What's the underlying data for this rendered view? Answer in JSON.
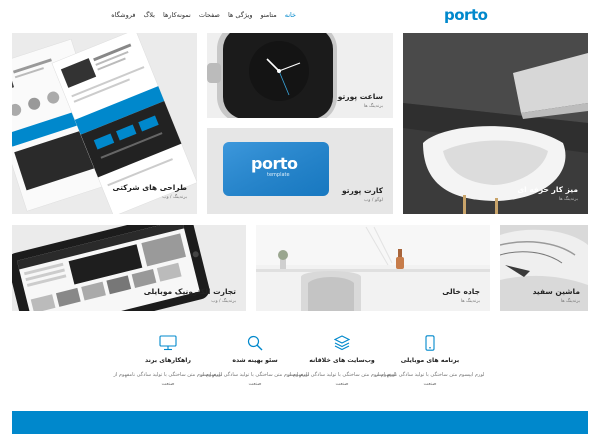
{
  "header": {
    "logo_text": "porto",
    "nav": [
      "خانه",
      "متامنو",
      "ویژگی ها",
      "صفحات",
      "نمونه‌کارها",
      "بلاگ",
      "فروشگاه"
    ]
  },
  "portfolio": [
    {
      "title": "طراحی های شرکتی",
      "subtitle": "برندینگ / وب"
    },
    {
      "title": "ساعت پورتو",
      "subtitle": "برندینگ ها"
    },
    {
      "title": "میز کار حرفه ای",
      "subtitle": "برندینگ ها"
    },
    {
      "title": "کارت پورتو",
      "subtitle": "لوگو / وب"
    },
    {
      "title": "تجارت الکترونیک موبایلی",
      "subtitle": "برندینگ / وب"
    },
    {
      "title": "جاده خالی",
      "subtitle": "برندینگ ها"
    },
    {
      "title": "ماشین سفید",
      "subtitle": "برندینگ ها"
    }
  ],
  "card_logo": {
    "name": "porto",
    "tag": "template"
  },
  "features": [
    {
      "icon": "mobile-icon",
      "title": "برنامه های موبایلی",
      "desc": "لورم ایپسوم متن ساختگی با تولید سادگی نامفهوم از صنعت"
    },
    {
      "icon": "layers-icon",
      "title": "وب‌سایت های خلاقانه",
      "desc": "لورم ایپسوم متن ساختگی با تولید سادگی نامفهوم از صنعت"
    },
    {
      "icon": "search-icon",
      "title": "سئو بهینه شده",
      "desc": "لورم ایپسوم متن ساختگی با تولید سادگی نامفهوم از صنعت"
    },
    {
      "icon": "monitor-icon",
      "title": "راهکارهای برند",
      "desc": "لورم ایپسوم متن ساختگی با تولید سادگی نامفهوم از صنعت"
    }
  ],
  "colors": {
    "accent": "#0088cc",
    "text": "#222222",
    "muted": "#777777"
  }
}
